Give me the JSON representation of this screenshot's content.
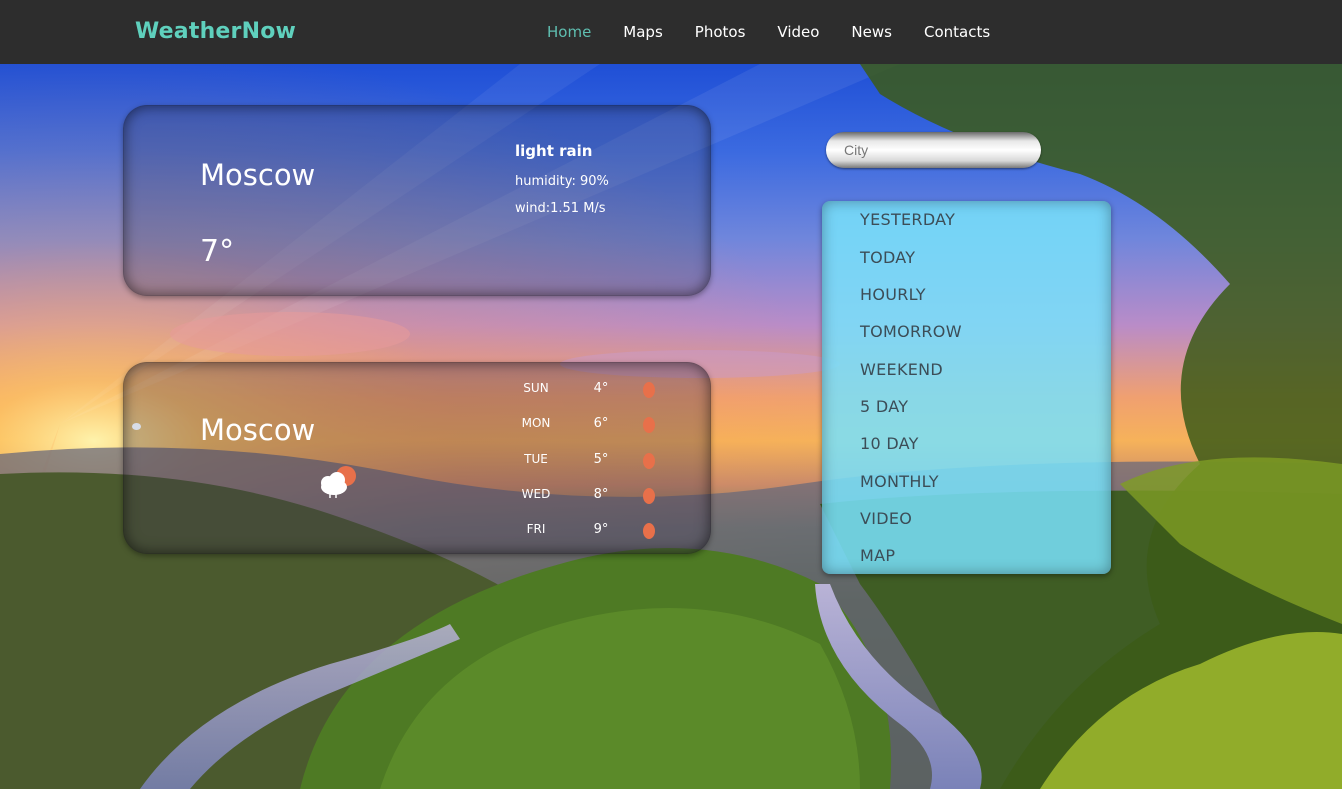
{
  "brand": "WeatherNow",
  "nav": {
    "items": [
      {
        "label": "Home",
        "active": true
      },
      {
        "label": "Maps"
      },
      {
        "label": "Photos"
      },
      {
        "label": "Video"
      },
      {
        "label": "News"
      },
      {
        "label": "Contacts"
      }
    ]
  },
  "current": {
    "city": "Moscow",
    "temperature": "7°",
    "condition": "light rain",
    "humidity": "humidity: 90%",
    "wind": "wind:1.51 M/s"
  },
  "forecast": {
    "city": "Moscow",
    "icon": "cloud-sun-icon",
    "days": [
      {
        "day": "SUN",
        "temp": "4°"
      },
      {
        "day": "MON",
        "temp": "6°"
      },
      {
        "day": "TUE",
        "temp": "5°"
      },
      {
        "day": "WED",
        "temp": "8°"
      },
      {
        "day": "FRI",
        "temp": "9°"
      }
    ]
  },
  "search": {
    "placeholder": "City"
  },
  "menu": {
    "items": [
      "YESTERDAY",
      "TODAY",
      "HOURLY",
      "TOMORROW",
      "WEEKEND",
      "5 DAY",
      "10 DAY",
      "MONTHLY",
      "VIDEO",
      "MAP"
    ]
  },
  "colors": {
    "brand": "#5fd0bd",
    "nav_active": "#5fbfb1",
    "nav_bg": "#2d2d2d",
    "menu_bg": "#78e1fa",
    "forecast_dot": "#e8704a"
  }
}
